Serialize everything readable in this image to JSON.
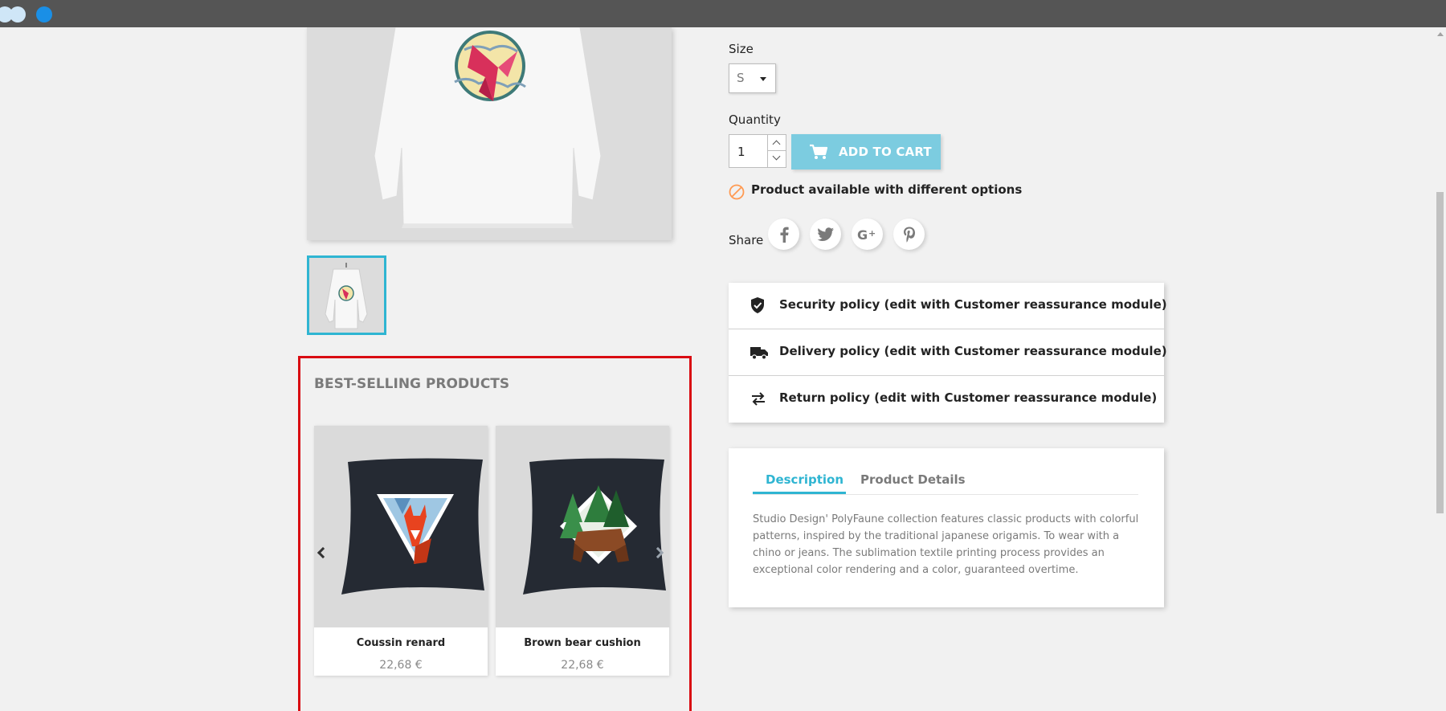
{
  "window": {
    "controls": [
      "dot",
      "dot",
      "dot"
    ]
  },
  "product": {
    "size_label": "Size",
    "size_value": "S",
    "quantity_label": "Quantity",
    "quantity_value": "1",
    "add_to_cart_label": "ADD TO CART",
    "availability": "Product available with different options",
    "share_label": "Share",
    "social_icons": [
      "facebook-icon",
      "twitter-icon",
      "google-plus-icon",
      "pinterest-icon"
    ]
  },
  "reassurance": [
    {
      "icon": "shield-check-icon",
      "label": "Security policy (edit with Customer reassurance module)"
    },
    {
      "icon": "truck-icon",
      "label": "Delivery policy (edit with Customer reassurance module)"
    },
    {
      "icon": "swap-arrows-icon",
      "label": "Return policy (edit with Customer reassurance module)"
    }
  ],
  "tabs": {
    "items": [
      "Description",
      "Product Details"
    ],
    "active": "Description",
    "description": "Studio Design' PolyFaune collection features classic products with colorful patterns, inspired by the traditional japanese origamis. To wear with a chino or jeans. The sublimation textile printing process provides an exceptional color rendering and a color, guaranteed overtime."
  },
  "bestsellers": {
    "title": "BEST-SELLING PRODUCTS",
    "products": [
      {
        "name": "Coussin renard",
        "price": "22,68 €"
      },
      {
        "name": "Brown bear cushion",
        "price": "22,68 €"
      }
    ]
  },
  "colors": {
    "accent": "#2fb5d2",
    "cart_button": "#7ccce0",
    "highlight_box": "#d90b12"
  }
}
